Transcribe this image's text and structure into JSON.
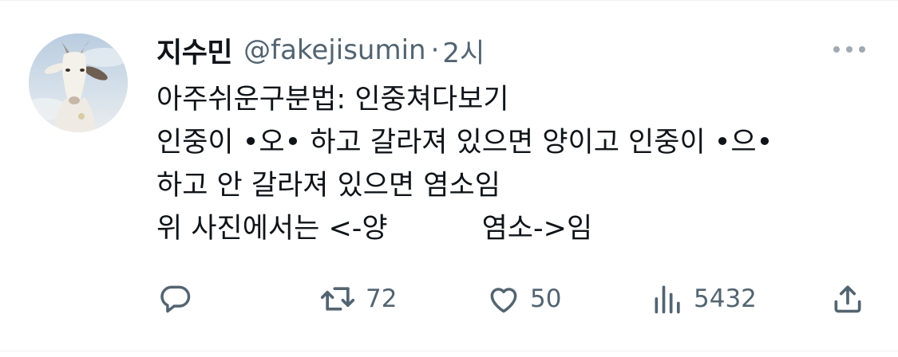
{
  "author": {
    "display_name": "지수민",
    "handle": "@fakejisumin",
    "separator": "·",
    "time": "2시"
  },
  "tweet": {
    "lines": [
      "아주쉬운구분법: 인중쳐다보기",
      "인중이 •오• 하고 갈라져 있으면 양이고 인중이 •으•",
      "하고 안 갈라져 있으면 염소임"
    ],
    "line4_left": "위 사진에서는 <-양",
    "line4_right": "염소->임"
  },
  "actions": {
    "reply_count": "",
    "retweet_count": "72",
    "like_count": "50",
    "views_count": "5432"
  },
  "icons": {
    "avatar": "goat-avatar",
    "more": "more-icon",
    "reply": "reply-icon",
    "retweet": "retweet-icon",
    "like": "heart-icon",
    "views": "views-icon",
    "share": "share-icon"
  },
  "colors": {
    "text": "#0f1419",
    "secondary": "#536471",
    "border": "#eff3f4"
  }
}
